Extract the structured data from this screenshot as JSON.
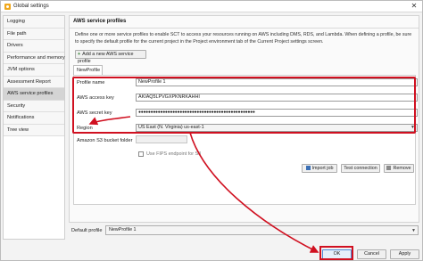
{
  "window": {
    "title": "Global settings",
    "close_glyph": "✕",
    "app_icon": "settings-app-icon"
  },
  "sidebar": {
    "items": [
      {
        "label": "Logging"
      },
      {
        "label": "File path"
      },
      {
        "label": "Drivers"
      },
      {
        "label": "Performance and memory"
      },
      {
        "label": "JVM options"
      },
      {
        "label": "Assessment Report"
      },
      {
        "label": "AWS service profiles",
        "active": true
      },
      {
        "label": "Security"
      },
      {
        "label": "Notifications"
      },
      {
        "label": "Tree view"
      }
    ]
  },
  "panel": {
    "title": "AWS service profiles",
    "description": "Define one or more service profiles to enable SCT to access your resources running on AWS including DMS, RDS, and Lambda. When defining a profile, be sure to specify the default profile for the current project in the Project environment tab of the Current Project settings screen.",
    "add_button": "Add a new AWS service profile",
    "tab_label": "NewProfile 1"
  },
  "form": {
    "profile_name": {
      "label": "Profile name",
      "value": "NewProfile 1"
    },
    "access_key": {
      "label": "AWS access key",
      "value": "AKIAQ5LPVGXPKNRKAHHI"
    },
    "secret_key": {
      "label": "AWS secret key",
      "value": "●●●●●●●●●●●●●●●●●●●●●●●●●●●●●●●●●●●●●●●●●●●●●●●●"
    },
    "region": {
      "label": "Region",
      "value": "US East (N. Virginia) us-east-1"
    },
    "s3_folder": {
      "label": "Amazon S3 bucket folder",
      "value": ""
    },
    "fips": {
      "label": "Use FIPS endpoint for S3",
      "checked": false
    }
  },
  "actions": {
    "import_job": "Import job",
    "test_connection": "Test connection",
    "remove": "Remove"
  },
  "footer": {
    "default_profile_label": "Default profile",
    "default_profile_value": "NewProfile 1",
    "ok": "OK",
    "cancel": "Cancel",
    "apply": "Apply"
  },
  "colors": {
    "highlight": "#d01020",
    "active_sidebar": "#d4d4d4",
    "ok_accent": "#4c8ad6"
  }
}
